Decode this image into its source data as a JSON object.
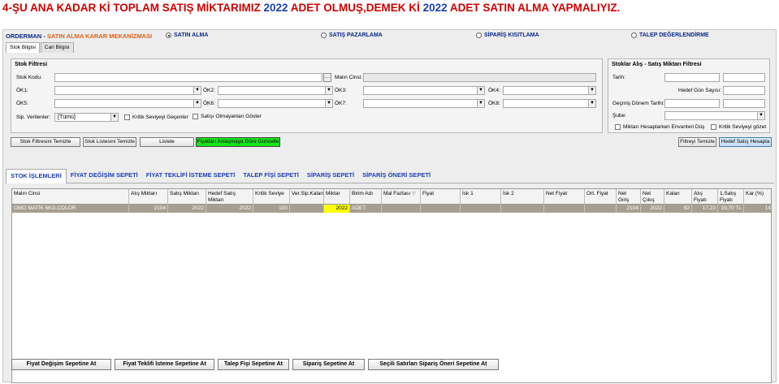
{
  "headline": {
    "part1": "4-ŞU ANA KADAR Kİ TOPLAM SATIŞ MİKTARIMIZ ",
    "num1": "2022",
    "part2": " ADET OLMUŞ,DEMEK Kİ ",
    "num2": "2022",
    "part3": " ADET SATIN ALMA YAPMALIYIZ."
  },
  "app": {
    "title_prefix": "ORDERMAN - ",
    "title_highlight": "SATIN ALMA KARAR MEKANİZMASI",
    "modes": [
      "SATIN ALMA",
      "SATIŞ PAZARLAMA",
      "SİPARİŞ KISITLAMA",
      "TALEP DEĞERLENDİRME"
    ],
    "tabs": [
      "Stok Bilgisi",
      "Cari Bilgisi"
    ]
  },
  "filter": {
    "title": "Stok Filtresi",
    "stok_kodu": "Stok Kodu:",
    "malin_cinsi": "Malın Cinsi:",
    "ok": [
      "ÖK1:",
      "ÖK2:",
      "ÖK3:",
      "ÖK4:",
      "ÖK5:",
      "ÖK6:",
      "ÖK7:",
      "ÖK8:"
    ],
    "sip_verilenler": "Sip. Verilenler:",
    "sip_value": "[Tümü]",
    "kritik": "Kritik Seviyeyi Geçenler",
    "satisi_olmayan": "Satışı Olmayanları Göster"
  },
  "right_filter": {
    "title": "Stoklar Alış - Satış Miktarı Filtresi",
    "tarih": "Tarih:",
    "hedef_gun": "Hedef Gün Sayısı:",
    "gecmis_donem": "Geçmiş Dönem Tarihi:",
    "sube": "Şube:",
    "miktari_hesap": "Miktarı Hesaplarken Envanteri Düş",
    "kritik_gozet": "Kritik Seviyeyi gözet"
  },
  "actions": {
    "stok_filtresini_temizle": "Stok Filtresini Temizle",
    "stok_listesini_temizle": "Stok Listesini Temizle",
    "listele": "Listele",
    "fiyatlari_guncelle": "Fiyatları Anlaşmaya Göre Güncelle",
    "filtreyi_temizle": "Filtreyi Temizle",
    "hedef_satis_hesapla": "Hedef Satış Hesapla"
  },
  "subtabs": [
    "STOK İŞLEMLERİ",
    "FİYAT DEĞİŞİM SEPETİ",
    "FİYAT TEKLİFİ İSTEME SEPETİ",
    "TALEP FİŞİ SEPETİ",
    "SİPARİŞ SEPETİ",
    "SİPARİŞ ÖNERİ SEPETİ"
  ],
  "grid": {
    "columns": [
      "Malın Cinsi",
      "Alış Miktarı",
      "Satış Miktarı",
      "Hedef Satış Miktarı",
      "Kritik Seviye",
      "Ver.Sip.Kalan",
      "Miktar",
      "Birim Adı",
      "Mal Fazlası",
      "Fiyat",
      "İsk 1",
      "İsk 2",
      "Net Fiyat",
      "Ort. Fiyat",
      "Net Giriş",
      "Net Çıkış",
      "Kalan",
      "Alış Fiyatı",
      "1.Satış Fiyatı",
      "Kar (%)"
    ],
    "rows": [
      [
        "OMO MATİK 6KG.COLOR",
        "2104",
        "2022",
        "2022",
        "100",
        "",
        "2022",
        "ADET",
        "",
        "",
        "",
        "",
        "",
        "",
        "2104",
        "2022",
        "82",
        "17,23",
        "19,70 TL",
        "14"
      ]
    ]
  },
  "bottom_buttons": [
    "Fiyat Değişim Sepetine At",
    "Fiyat Teklifi İsteme Sepetine At",
    "Talep Fişi Sepetine At",
    "Sipariş Sepetine At",
    "Seçili Satırları Sipariş Öneri Sepetine At"
  ],
  "colors": {
    "headline_red": "#d00000",
    "headline_blue": "#1c3fb0",
    "row_bg": "#a79e92",
    "highlight_yellow": "#ffff00",
    "green_button": "#17e51b"
  }
}
